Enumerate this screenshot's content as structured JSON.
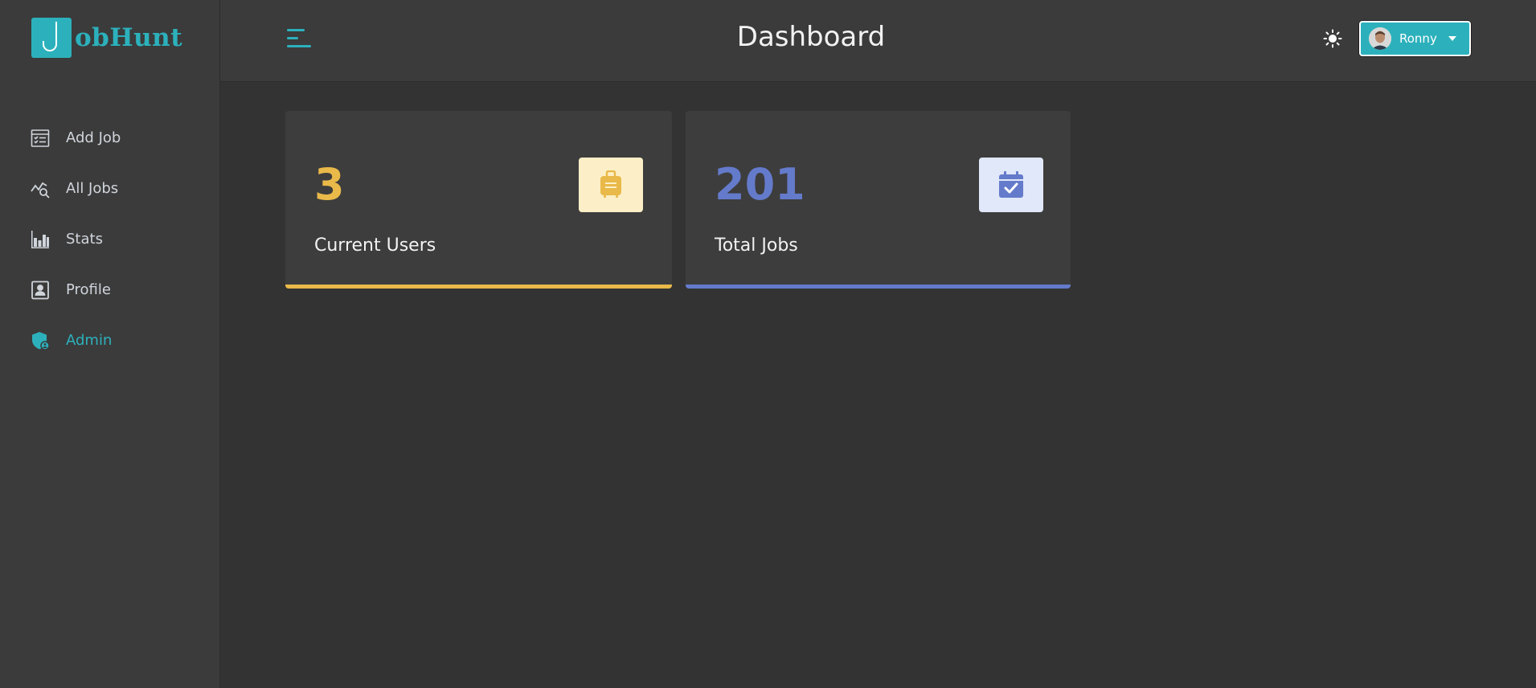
{
  "brand": {
    "logo_letter": "J",
    "name": "obHunt",
    "color": "#2cb1bc"
  },
  "sidebar": {
    "items": [
      {
        "label": "Add Job",
        "icon": "add-job-icon",
        "active": false
      },
      {
        "label": "All Jobs",
        "icon": "all-jobs-icon",
        "active": false
      },
      {
        "label": "Stats",
        "icon": "stats-icon",
        "active": false
      },
      {
        "label": "Profile",
        "icon": "profile-icon",
        "active": false
      },
      {
        "label": "Admin",
        "icon": "admin-shield-icon",
        "active": true
      }
    ]
  },
  "header": {
    "title": "Dashboard",
    "theme_icon": "sun-icon",
    "user": {
      "name": "Ronny"
    }
  },
  "stats": [
    {
      "count": "3",
      "label": "Current Users",
      "color": "#e9b949",
      "icon_bg": "#fcefc7",
      "icon": "suitcase-icon"
    },
    {
      "count": "201",
      "label": "Total Jobs",
      "color": "#647acb",
      "icon_bg": "#e0e8f9",
      "icon": "calendar-check-icon"
    }
  ]
}
